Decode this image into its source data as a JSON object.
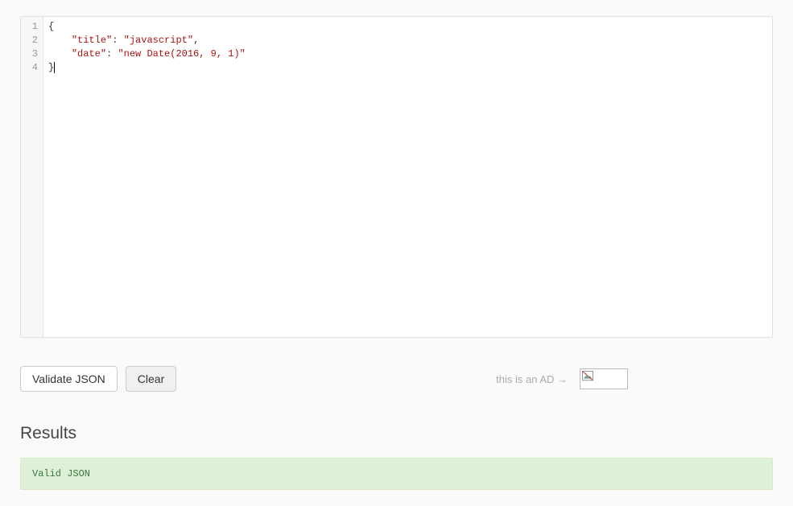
{
  "editor": {
    "lines": [
      {
        "num": "1",
        "tokens": [
          {
            "t": "punct",
            "v": "{"
          }
        ]
      },
      {
        "num": "2",
        "tokens": [
          {
            "t": "indent",
            "v": "    "
          },
          {
            "t": "str",
            "v": "\"title\""
          },
          {
            "t": "punct",
            "v": ": "
          },
          {
            "t": "str",
            "v": "\"javascript\""
          },
          {
            "t": "punct",
            "v": ","
          }
        ]
      },
      {
        "num": "3",
        "tokens": [
          {
            "t": "indent",
            "v": "    "
          },
          {
            "t": "str",
            "v": "\"date\""
          },
          {
            "t": "punct",
            "v": ": "
          },
          {
            "t": "str",
            "v": "\"new Date(2016, 9, 1)\""
          }
        ]
      },
      {
        "num": "4",
        "tokens": [
          {
            "t": "punct",
            "v": "}"
          }
        ],
        "cursor": true
      }
    ]
  },
  "buttons": {
    "validate": "Validate JSON",
    "clear": "Clear"
  },
  "ad": {
    "label": "this is an AD →"
  },
  "results": {
    "heading": "Results",
    "message": "Valid JSON"
  }
}
